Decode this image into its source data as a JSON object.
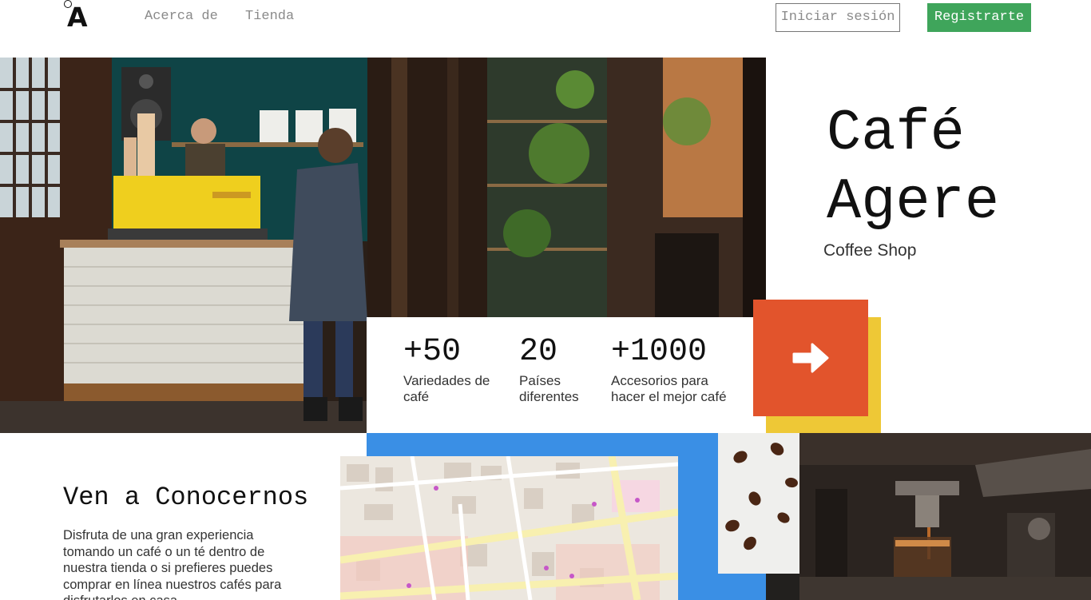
{
  "nav": {
    "logo_letter": "A",
    "links": [
      "Acerca de",
      "Tienda"
    ],
    "login_label": "Iniciar sesión",
    "register_label": "Registrarte"
  },
  "hero": {
    "title_line1": "Café",
    "title_line2": "Agere",
    "subtitle": "Coffee Shop"
  },
  "stats": [
    {
      "number": "+50",
      "label_line1": "Variedades de",
      "label_line2": "café"
    },
    {
      "number": "20",
      "label_line1": "Países",
      "label_line2": "diferentes"
    },
    {
      "number": "+1000",
      "label_line1": "Accesorios para",
      "label_line2": "hacer el mejor café"
    }
  ],
  "cta": {
    "icon": "arrow-right-icon"
  },
  "visit": {
    "title": "Ven a Conocernos",
    "text": "Disfruta de una gran experiencia tomando un café o un té dentro de nuestra tienda o si prefieres puedes comprar en línea nuestros cafés para disfrutarlos en casa."
  },
  "colors": {
    "accent_orange": "#e2542c",
    "accent_yellow": "#eec836",
    "accent_blue": "#3a8fe5",
    "register_green": "#3fa55b"
  }
}
